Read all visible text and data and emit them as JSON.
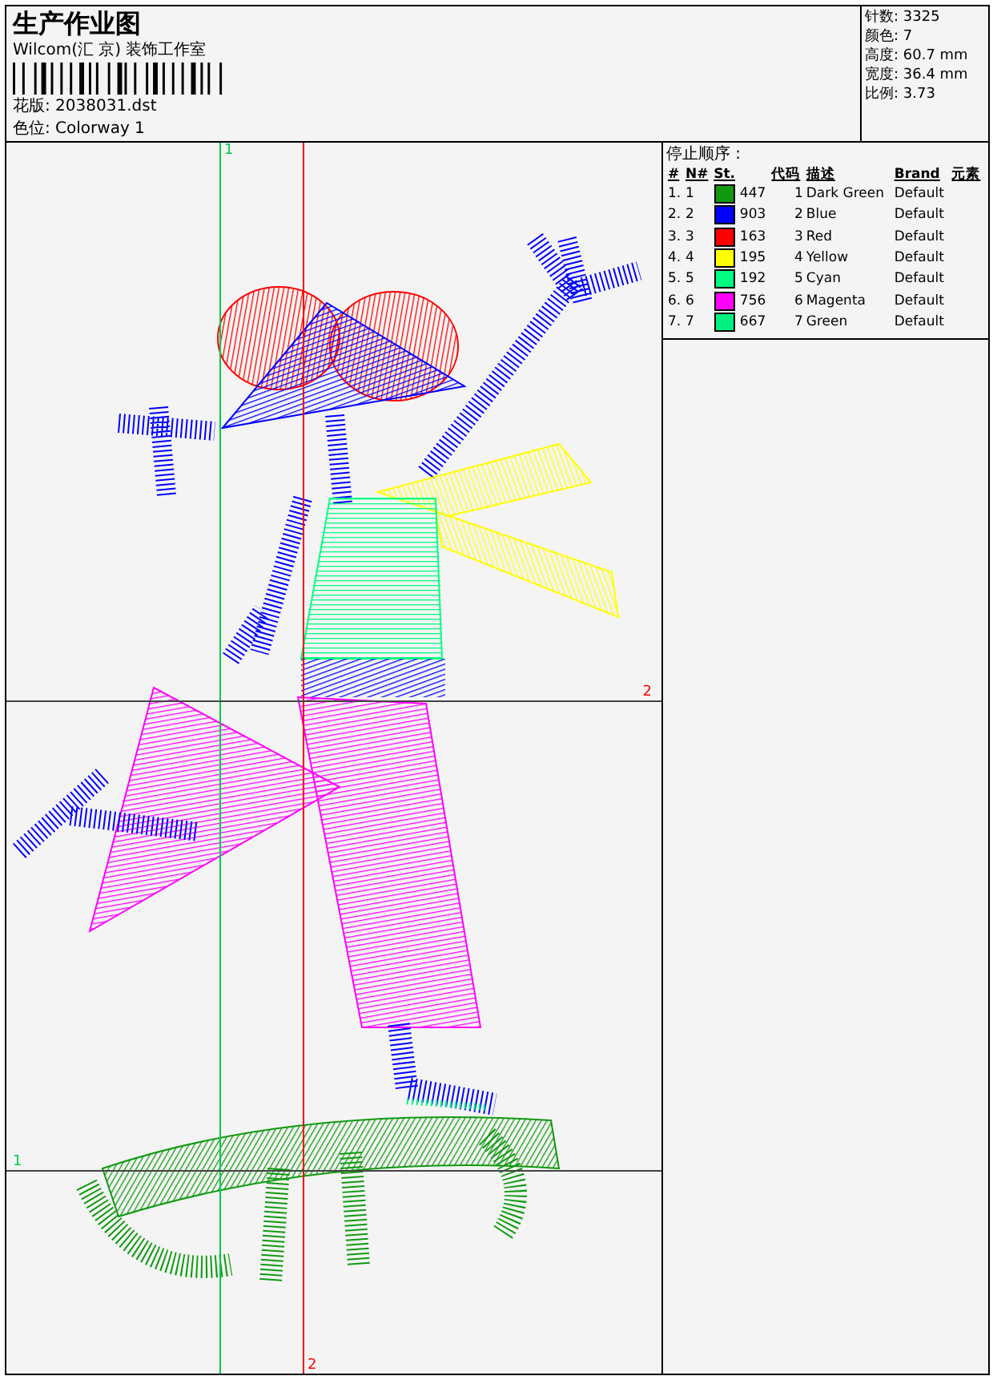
{
  "header": {
    "title": "生产作业图",
    "company": "Wilcom(汇 京) 装饰工作室",
    "design": "花版: 2038031.dst",
    "colorway": "色位: Colorway 1"
  },
  "stats": [
    "针数: 3325",
    "颜色: 7",
    "高度: 60.7 mm",
    "宽度: 36.4 mm",
    "比例: 3.73"
  ],
  "stop_sequence": {
    "title": "停止顺序 :",
    "columns": [
      "#",
      "N#",
      "St.",
      "代码",
      "描述",
      "Brand",
      "元素"
    ],
    "rows": [
      {
        "index": "1.",
        "number": "1",
        "color": "#109a10",
        "stitches": "447",
        "code": "1",
        "description": "Dark Green",
        "brand": "Default"
      },
      {
        "index": "2.",
        "number": "2",
        "color": "#0000ff",
        "stitches": "903",
        "code": "2",
        "description": "Blue",
        "brand": "Default"
      },
      {
        "index": "3.",
        "number": "3",
        "color": "#ff0000",
        "stitches": "163",
        "code": "3",
        "description": "Red",
        "brand": "Default"
      },
      {
        "index": "4.",
        "number": "4",
        "color": "#ffff00",
        "stitches": "195",
        "code": "4",
        "description": "Yellow",
        "brand": "Default"
      },
      {
        "index": "5.",
        "number": "5",
        "color": "#00ff80",
        "stitches": "192",
        "code": "5",
        "description": "Cyan",
        "brand": "Default"
      },
      {
        "index": "6.",
        "number": "6",
        "color": "#ff00ff",
        "stitches": "756",
        "code": "6",
        "description": "Magenta",
        "brand": "Default"
      },
      {
        "index": "7.",
        "number": "7",
        "color": "#00f080",
        "stitches": "667",
        "code": "7",
        "description": "Green",
        "brand": "Default"
      }
    ]
  },
  "canvas": {
    "guides": [
      {
        "label": "1",
        "kind": "vertical",
        "color": "#00cc44"
      },
      {
        "label": "2",
        "kind": "vertical",
        "color": "#ff0000"
      },
      {
        "label": "2",
        "kind": "horizontal",
        "color": "#ff0000"
      },
      {
        "label": "1",
        "kind": "horizontal",
        "color": "#00cc44"
      }
    ]
  }
}
